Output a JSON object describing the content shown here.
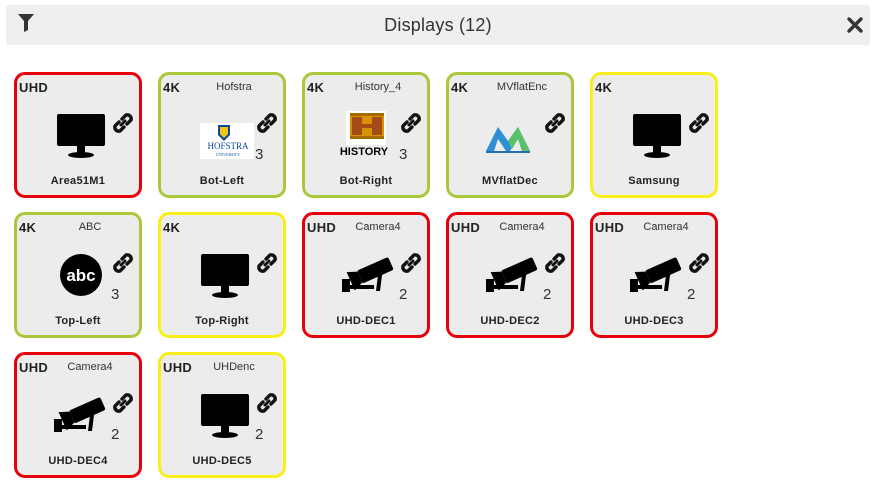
{
  "header": {
    "title": "Displays (12)",
    "filter_icon": "filter-icon",
    "close_icon": "close-icon"
  },
  "colors": {
    "red": "#e7000b",
    "green": "#a9c83a",
    "yellow": "#f7ef1a"
  },
  "tiles": [
    {
      "res": "UHD",
      "source": "",
      "name": "Area51M1",
      "border": "red",
      "icon": "monitor-icon",
      "count": ""
    },
    {
      "res": "4K",
      "source": "Hofstra",
      "name": "Bot-Left",
      "border": "green",
      "icon": "hofstra-logo",
      "count": "3",
      "logo_text": "HOFSTRA",
      "logo_sub": "UNIVERSITY"
    },
    {
      "res": "4K",
      "source": "History_4",
      "name": "Bot-Right",
      "border": "green",
      "icon": "history-logo",
      "count": "3",
      "logo_text": "HISTORY"
    },
    {
      "res": "4K",
      "source": "MVflatEnc",
      "name": "MVflatDec",
      "border": "green",
      "icon": "mvflat-logo",
      "count": ""
    },
    {
      "res": "4K",
      "source": "",
      "name": "Samsung",
      "border": "yellow",
      "icon": "monitor-icon",
      "count": ""
    },
    {
      "res": "4K",
      "source": "ABC",
      "name": "Top-Left",
      "border": "green",
      "icon": "abc-logo",
      "count": "3",
      "logo_text": "abc"
    },
    {
      "res": "4K",
      "source": "",
      "name": "Top-Right",
      "border": "yellow",
      "icon": "monitor-icon",
      "count": ""
    },
    {
      "res": "UHD",
      "source": "Camera4",
      "name": "UHD-DEC1",
      "border": "red",
      "icon": "camera-icon",
      "count": "2"
    },
    {
      "res": "UHD",
      "source": "Camera4",
      "name": "UHD-DEC2",
      "border": "red",
      "icon": "camera-icon",
      "count": "2"
    },
    {
      "res": "UHD",
      "source": "Camera4",
      "name": "UHD-DEC3",
      "border": "red",
      "icon": "camera-icon",
      "count": "2"
    },
    {
      "res": "UHD",
      "source": "Camera4",
      "name": "UHD-DEC4",
      "border": "red",
      "icon": "camera-icon",
      "count": "2"
    },
    {
      "res": "UHD",
      "source": "UHDenc",
      "name": "UHD-DEC5",
      "border": "yellow",
      "icon": "monitor-icon",
      "count": "2"
    }
  ]
}
